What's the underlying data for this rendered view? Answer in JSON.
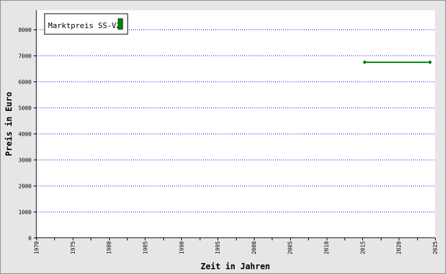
{
  "chart_data": {
    "type": "line",
    "xlabel": "Zeit in Jahren",
    "ylabel": "Preis in Euro",
    "xlim": [
      1970,
      2025
    ],
    "ylim": [
      0,
      8750
    ],
    "x_tick_labels": [
      "1970",
      "1975",
      "1980",
      "1985",
      "1990",
      "1995",
      "2000",
      "2005",
      "2010",
      "2015",
      "2020",
      "2025"
    ],
    "y_tick_labels": [
      "0",
      "1000",
      "2000",
      "3000",
      "4000",
      "5000",
      "6000",
      "7000",
      "8000"
    ],
    "grid": "horizontal dotted",
    "legend_position": "top-left",
    "series": [
      {
        "name": "Marktpreis SS-VZ",
        "color": "#008000",
        "points": [
          {
            "x": 2015.3,
            "y": 6750
          },
          {
            "x": 2024.3,
            "y": 6750
          }
        ]
      }
    ]
  },
  "colors": {
    "background": "#e6e6e6",
    "plot_background": "#ffffff",
    "grid": "#0000ff",
    "series": "#008000"
  }
}
